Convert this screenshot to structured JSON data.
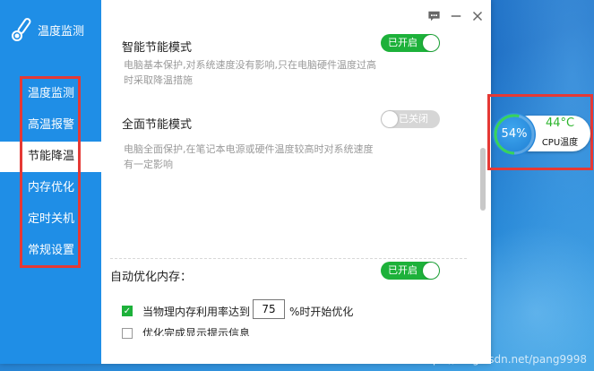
{
  "app": {
    "title": "温度监测"
  },
  "sidebar": {
    "items": [
      {
        "label": "温度监测",
        "active": false
      },
      {
        "label": "高温报警",
        "active": false
      },
      {
        "label": "节能降温",
        "active": true
      },
      {
        "label": "内存优化",
        "active": false
      },
      {
        "label": "定时关机",
        "active": false
      },
      {
        "label": "常规设置",
        "active": false
      }
    ]
  },
  "toolbar": {
    "icons": [
      "chat-icon",
      "minimize-icon",
      "close-icon"
    ]
  },
  "smart_mode": {
    "title": "智能节能模式",
    "toggle_label": "已开启",
    "enabled": true,
    "desc_line1": "电脑基本保护,对系统速度没有影响,只在电脑硬件温度过高",
    "desc_line2": "时采取降温措施"
  },
  "full_mode": {
    "title": "全面节能模式",
    "toggle_label": "已关闭",
    "enabled": false,
    "desc_line1": "电脑全面保护,在笔记本电源或硬件温度较高时对系统速度",
    "desc_line2": "有一定影响"
  },
  "memory": {
    "title": "自动优化内存：",
    "toggle_label": "已开启",
    "enabled": true,
    "option1_prefix": "当物理内存利用率达到",
    "option1_value": "75",
    "option1_suffix": "%时开始优化",
    "option1_checked": true,
    "option2_label": "优化完成显示提示信息",
    "option2_checked": false
  },
  "widget": {
    "percent": "54%",
    "percent_value": 54,
    "temperature": "44°C",
    "label": "CPU温度"
  },
  "watermark": "https://blog.csdn.net/pang9998",
  "colors": {
    "accent": "#1f8ee6",
    "toggle_on": "#1db13a",
    "highlight": "#e53935"
  }
}
